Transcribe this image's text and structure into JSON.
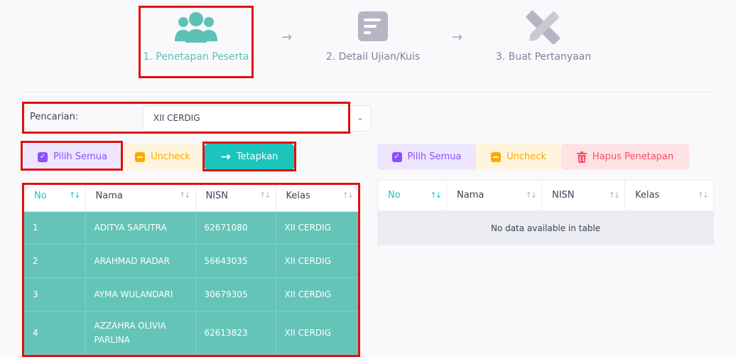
{
  "steps": [
    {
      "label": "1. Penetapan Peserta",
      "icon": "users-icon"
    },
    {
      "label": "2. Detail Ujian/Kuis",
      "icon": "document-icon"
    },
    {
      "label": "3. Buat Pertanyaan",
      "icon": "pencil-ruler-icon"
    }
  ],
  "search": {
    "label": "Pencarian:",
    "value": "XII CERDIG"
  },
  "left_actions": {
    "select_all": "Pilih Semua",
    "uncheck": "Uncheck",
    "assign": "Tetapkan"
  },
  "right_actions": {
    "select_all": "Pilih Semua",
    "uncheck": "Uncheck",
    "remove": "Hapus Penetapan"
  },
  "left_table": {
    "headers": [
      "No",
      "Nama",
      "NISN",
      "Kelas"
    ],
    "rows": [
      [
        "1",
        "ADITYA SAPUTRA",
        "62671080",
        "XII CERDIG"
      ],
      [
        "2",
        "ARAHMAD RADAR",
        "56643035",
        "XII CERDIG"
      ],
      [
        "3",
        "AYMA WULANDARI",
        "30679305",
        "XII CERDIG"
      ],
      [
        "4",
        "AZZAHRA OLIVIA PARLINA",
        "62613823",
        "XII CERDIG"
      ]
    ]
  },
  "right_table": {
    "headers": [
      "No",
      "Nama",
      "NISN",
      "Kelas"
    ],
    "empty": "No data available in table"
  },
  "colors": {
    "accent": "#1bc5bd",
    "row_selected": "#64c4b8",
    "highlight": "#e10f0f"
  }
}
